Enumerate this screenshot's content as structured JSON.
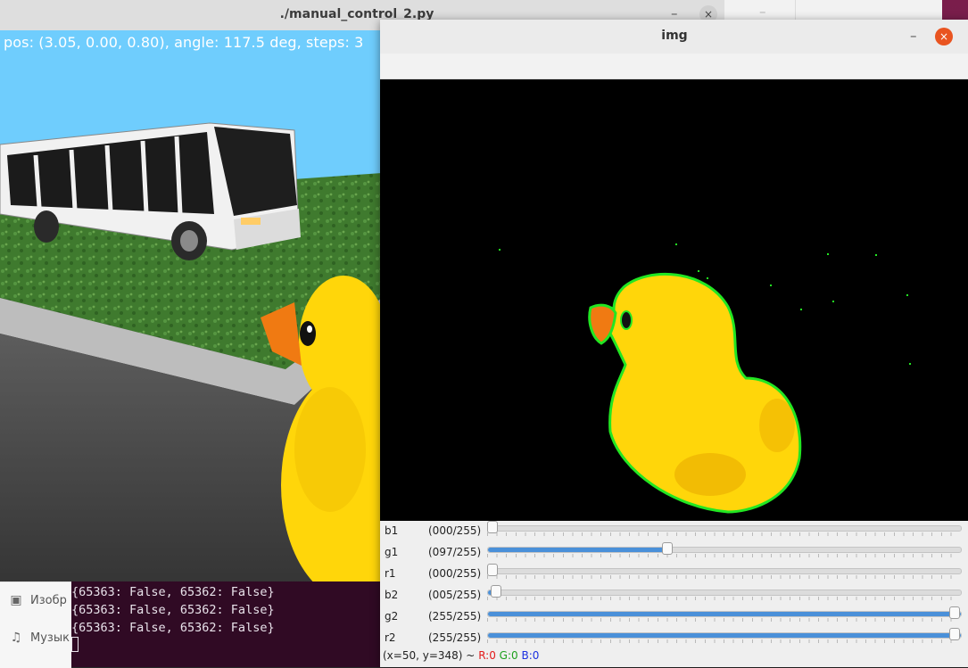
{
  "main_window": {
    "title": "./manual_control_2.py",
    "minimize_glyph": "–",
    "close_glyph": "×",
    "hud_text": "pos: (3.05, 0.00, 0.80), angle: 117.5 deg, steps: 3"
  },
  "terminal": {
    "lines": [
      "{65363: False, 65362: False}",
      "{65363: False, 65362: False}",
      "{65363: False, 65362: False}"
    ]
  },
  "files_sidebar": {
    "items": [
      {
        "label": "Изобр",
        "icon": "image-icon",
        "glyph": "▣"
      },
      {
        "label": "Музык",
        "icon": "music-icon",
        "glyph": "♫"
      }
    ]
  },
  "background_window": {
    "minimize_glyph": "–",
    "close_glyph": "×"
  },
  "img_window": {
    "title": "img",
    "minimize_glyph": "–",
    "close_glyph": "×"
  },
  "trackbars": [
    {
      "name": "b1",
      "value_text": "(000/255)",
      "value": 0
    },
    {
      "name": "g1",
      "value_text": "(097/255)",
      "value": 97
    },
    {
      "name": "r1",
      "value_text": "(000/255)",
      "value": 0
    },
    {
      "name": "b2",
      "value_text": "(005/255)",
      "value": 5
    },
    {
      "name": "g2",
      "value_text": "(255/255)",
      "value": 255
    },
    {
      "name": "r2",
      "value_text": "(255/255)",
      "value": 255
    }
  ],
  "trackbar_max": 255,
  "status_bar": {
    "coords": "(x=50, y=348) ~",
    "r": "R:0",
    "g": "G:0",
    "b": "B:0"
  },
  "colors": {
    "accent": "#4a90d9",
    "close_button": "#e95420",
    "terminal_bg": "#300a24",
    "contour": "#22e622",
    "duck": "#ffd60a",
    "beak": "#f07a12"
  }
}
